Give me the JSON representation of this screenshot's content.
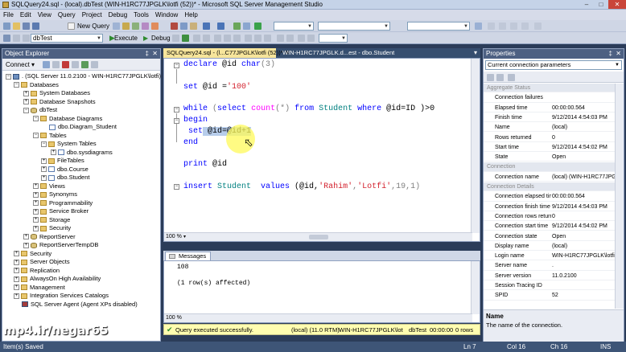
{
  "window": {
    "title": "SQLQuery24.sql - (local).dbTest (WIN-H1RC77JPGLK\\lotfi (52))* - Microsoft SQL Server Management Studio"
  },
  "menu": [
    "File",
    "Edit",
    "View",
    "Query",
    "Project",
    "Debug",
    "Tools",
    "Window",
    "Help"
  ],
  "toolbar": {
    "new_query": "New Query",
    "database_combo": "dbTest",
    "execute": "Execute",
    "debug": "Debug"
  },
  "object_explorer": {
    "title": "Object Explorer",
    "connect": "Connect",
    "nodes": [
      ". (SQL Server 11.0.2100 - WIN-H1RC77JPGLK\\lotfi)",
      "Databases",
      "System Databases",
      "Database Snapshots",
      "dbTest",
      "Database Diagrams",
      "dbo.Diagram_Student",
      "Tables",
      "System Tables",
      "dbo.sysdiagrams",
      "FileTables",
      "dbo.Course",
      "dbo.Student",
      "Views",
      "Synonyms",
      "Programmability",
      "Service Broker",
      "Storage",
      "Security",
      "ReportServer",
      "ReportServerTempDB",
      "Security",
      "Server Objects",
      "Replication",
      "AlwaysOn High Availability",
      "Management",
      "Integration Services Catalogs",
      "SQL Server Agent (Agent XPs disabled)"
    ]
  },
  "tabs": [
    "SQLQuery24.sql - (l...C77JPGLK\\lotfi (52))*",
    "WIN-H1RC77JPGLK.d...est - dbo.Student"
  ],
  "code": {
    "l1_kw": "declare",
    "l1_rest": " @id ",
    "l1_type": "char",
    "l1_end": "(3)",
    "l2_kw": "set",
    "l2_rest": " @id =",
    "l2_str": "'100'",
    "l3_kw": "while",
    "l3_a": " (",
    "l3_kw2": "select",
    "l3_sp": " ",
    "l3_fn": "count",
    "l3_b": "(*) ",
    "l3_kw3": "from",
    "l3_c": " Student ",
    "l3_kw4": "where",
    "l3_d": " @id=ID )>0",
    "l4_kw": "begin",
    "l5_kw": "set",
    "l5_sel": " @id=@id+1",
    "l6_kw": "end",
    "l7_kw": "print",
    "l7_rest": " @id",
    "l8_kw": "insert",
    "l8_tbl": " Student",
    "l8_kw2": "  values",
    "l8_a": " (@id,",
    "l8_s1": "'Rahim'",
    "l8_b": ",",
    "l8_s2": "'Lotfi'",
    "l8_c": ",19,1)"
  },
  "zoom": "100 %",
  "messages": {
    "tab": "Messages",
    "line1": "108",
    "line2": "(1 row(s) affected)"
  },
  "query_status": {
    "message": "Query executed successfully.",
    "server": "(local) (11.0 RTM)",
    "user": "WIN-H1RC77JPGLK\\lotfi ...",
    "database": "dbTest",
    "time": "00:00:00",
    "rows": "0 rows"
  },
  "properties": {
    "title": "Properties",
    "combo": "Current connection parameters",
    "rows": [
      {
        "k": "Aggregate Status",
        "v": "",
        "cat": true
      },
      {
        "k": "Connection failures",
        "v": ""
      },
      {
        "k": "Elapsed time",
        "v": "00:00:00.564"
      },
      {
        "k": "Finish time",
        "v": "9/12/2014 4:54:03 PM"
      },
      {
        "k": "Name",
        "v": "(local)"
      },
      {
        "k": "Rows returned",
        "v": "0"
      },
      {
        "k": "Start time",
        "v": "9/12/2014 4:54:02 PM"
      },
      {
        "k": "State",
        "v": "Open"
      },
      {
        "k": "Connection",
        "v": "",
        "cat": true
      },
      {
        "k": "Connection name",
        "v": "(local) (WIN-H1RC77JPGLK\\l",
        "hl": true
      },
      {
        "k": "Connection Details",
        "v": "",
        "cat": true
      },
      {
        "k": "Connection elapsed tim",
        "v": "00:00:00.564"
      },
      {
        "k": "Connection finish time",
        "v": "9/12/2014 4:54:03 PM"
      },
      {
        "k": "Connection rows return",
        "v": "0"
      },
      {
        "k": "Connection start time",
        "v": "9/12/2014 4:54:02 PM"
      },
      {
        "k": "Connection state",
        "v": "Open"
      },
      {
        "k": "Display name",
        "v": "(local)"
      },
      {
        "k": "Login name",
        "v": "WIN-H1RC77JPGLK\\lotfi"
      },
      {
        "k": "Server name",
        "v": "."
      },
      {
        "k": "Server version",
        "v": "11.0.2100"
      },
      {
        "k": "Session Tracing ID",
        "v": ""
      },
      {
        "k": "SPID",
        "v": "52"
      }
    ],
    "desc_title": "Name",
    "desc_text": "The name of the connection."
  },
  "statusbar": {
    "left": "Item(s) Saved",
    "ln": "Ln 7",
    "col": "Col 16",
    "ch": "Ch 16",
    "ins": "INS"
  },
  "watermark": "mp4.ir/negar65"
}
